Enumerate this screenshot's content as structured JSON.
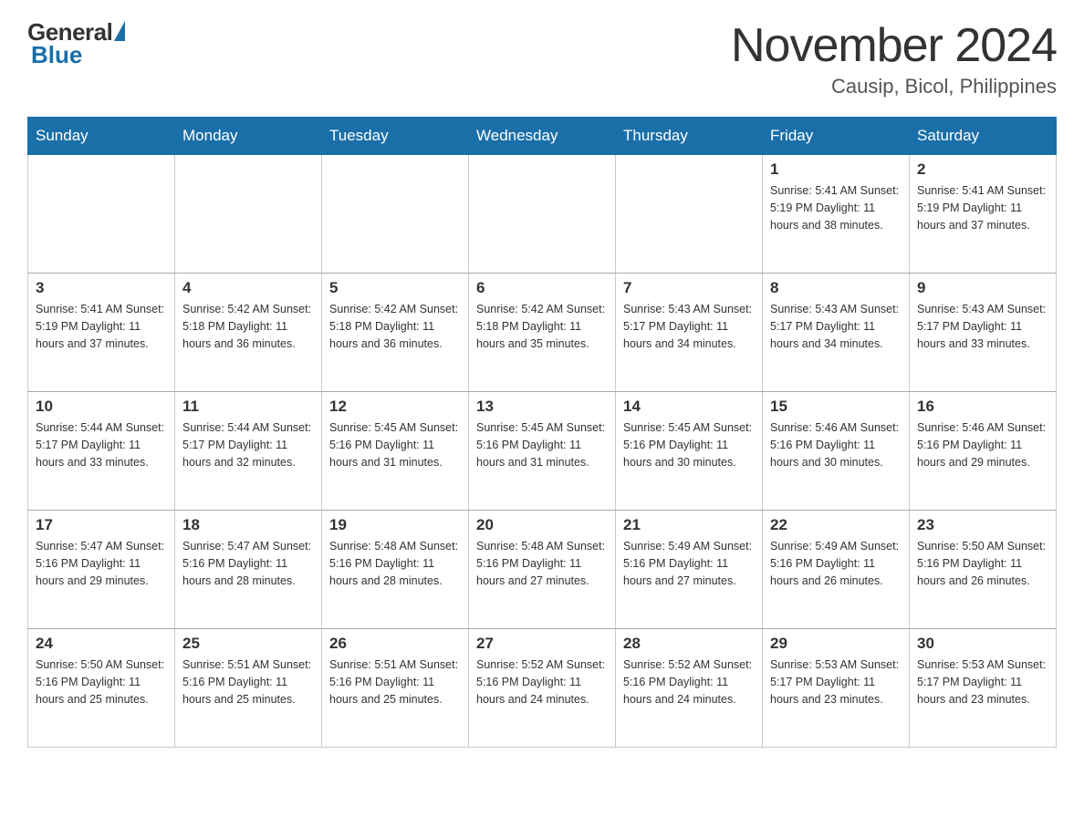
{
  "logo": {
    "general": "General",
    "blue": "Blue"
  },
  "header": {
    "month": "November 2024",
    "location": "Causip, Bicol, Philippines"
  },
  "weekdays": [
    "Sunday",
    "Monday",
    "Tuesday",
    "Wednesday",
    "Thursday",
    "Friday",
    "Saturday"
  ],
  "weeks": [
    [
      {
        "day": "",
        "info": ""
      },
      {
        "day": "",
        "info": ""
      },
      {
        "day": "",
        "info": ""
      },
      {
        "day": "",
        "info": ""
      },
      {
        "day": "",
        "info": ""
      },
      {
        "day": "1",
        "info": "Sunrise: 5:41 AM\nSunset: 5:19 PM\nDaylight: 11 hours and 38 minutes."
      },
      {
        "day": "2",
        "info": "Sunrise: 5:41 AM\nSunset: 5:19 PM\nDaylight: 11 hours and 37 minutes."
      }
    ],
    [
      {
        "day": "3",
        "info": "Sunrise: 5:41 AM\nSunset: 5:19 PM\nDaylight: 11 hours and 37 minutes."
      },
      {
        "day": "4",
        "info": "Sunrise: 5:42 AM\nSunset: 5:18 PM\nDaylight: 11 hours and 36 minutes."
      },
      {
        "day": "5",
        "info": "Sunrise: 5:42 AM\nSunset: 5:18 PM\nDaylight: 11 hours and 36 minutes."
      },
      {
        "day": "6",
        "info": "Sunrise: 5:42 AM\nSunset: 5:18 PM\nDaylight: 11 hours and 35 minutes."
      },
      {
        "day": "7",
        "info": "Sunrise: 5:43 AM\nSunset: 5:17 PM\nDaylight: 11 hours and 34 minutes."
      },
      {
        "day": "8",
        "info": "Sunrise: 5:43 AM\nSunset: 5:17 PM\nDaylight: 11 hours and 34 minutes."
      },
      {
        "day": "9",
        "info": "Sunrise: 5:43 AM\nSunset: 5:17 PM\nDaylight: 11 hours and 33 minutes."
      }
    ],
    [
      {
        "day": "10",
        "info": "Sunrise: 5:44 AM\nSunset: 5:17 PM\nDaylight: 11 hours and 33 minutes."
      },
      {
        "day": "11",
        "info": "Sunrise: 5:44 AM\nSunset: 5:17 PM\nDaylight: 11 hours and 32 minutes."
      },
      {
        "day": "12",
        "info": "Sunrise: 5:45 AM\nSunset: 5:16 PM\nDaylight: 11 hours and 31 minutes."
      },
      {
        "day": "13",
        "info": "Sunrise: 5:45 AM\nSunset: 5:16 PM\nDaylight: 11 hours and 31 minutes."
      },
      {
        "day": "14",
        "info": "Sunrise: 5:45 AM\nSunset: 5:16 PM\nDaylight: 11 hours and 30 minutes."
      },
      {
        "day": "15",
        "info": "Sunrise: 5:46 AM\nSunset: 5:16 PM\nDaylight: 11 hours and 30 minutes."
      },
      {
        "day": "16",
        "info": "Sunrise: 5:46 AM\nSunset: 5:16 PM\nDaylight: 11 hours and 29 minutes."
      }
    ],
    [
      {
        "day": "17",
        "info": "Sunrise: 5:47 AM\nSunset: 5:16 PM\nDaylight: 11 hours and 29 minutes."
      },
      {
        "day": "18",
        "info": "Sunrise: 5:47 AM\nSunset: 5:16 PM\nDaylight: 11 hours and 28 minutes."
      },
      {
        "day": "19",
        "info": "Sunrise: 5:48 AM\nSunset: 5:16 PM\nDaylight: 11 hours and 28 minutes."
      },
      {
        "day": "20",
        "info": "Sunrise: 5:48 AM\nSunset: 5:16 PM\nDaylight: 11 hours and 27 minutes."
      },
      {
        "day": "21",
        "info": "Sunrise: 5:49 AM\nSunset: 5:16 PM\nDaylight: 11 hours and 27 minutes."
      },
      {
        "day": "22",
        "info": "Sunrise: 5:49 AM\nSunset: 5:16 PM\nDaylight: 11 hours and 26 minutes."
      },
      {
        "day": "23",
        "info": "Sunrise: 5:50 AM\nSunset: 5:16 PM\nDaylight: 11 hours and 26 minutes."
      }
    ],
    [
      {
        "day": "24",
        "info": "Sunrise: 5:50 AM\nSunset: 5:16 PM\nDaylight: 11 hours and 25 minutes."
      },
      {
        "day": "25",
        "info": "Sunrise: 5:51 AM\nSunset: 5:16 PM\nDaylight: 11 hours and 25 minutes."
      },
      {
        "day": "26",
        "info": "Sunrise: 5:51 AM\nSunset: 5:16 PM\nDaylight: 11 hours and 25 minutes."
      },
      {
        "day": "27",
        "info": "Sunrise: 5:52 AM\nSunset: 5:16 PM\nDaylight: 11 hours and 24 minutes."
      },
      {
        "day": "28",
        "info": "Sunrise: 5:52 AM\nSunset: 5:16 PM\nDaylight: 11 hours and 24 minutes."
      },
      {
        "day": "29",
        "info": "Sunrise: 5:53 AM\nSunset: 5:17 PM\nDaylight: 11 hours and 23 minutes."
      },
      {
        "day": "30",
        "info": "Sunrise: 5:53 AM\nSunset: 5:17 PM\nDaylight: 11 hours and 23 minutes."
      }
    ]
  ]
}
